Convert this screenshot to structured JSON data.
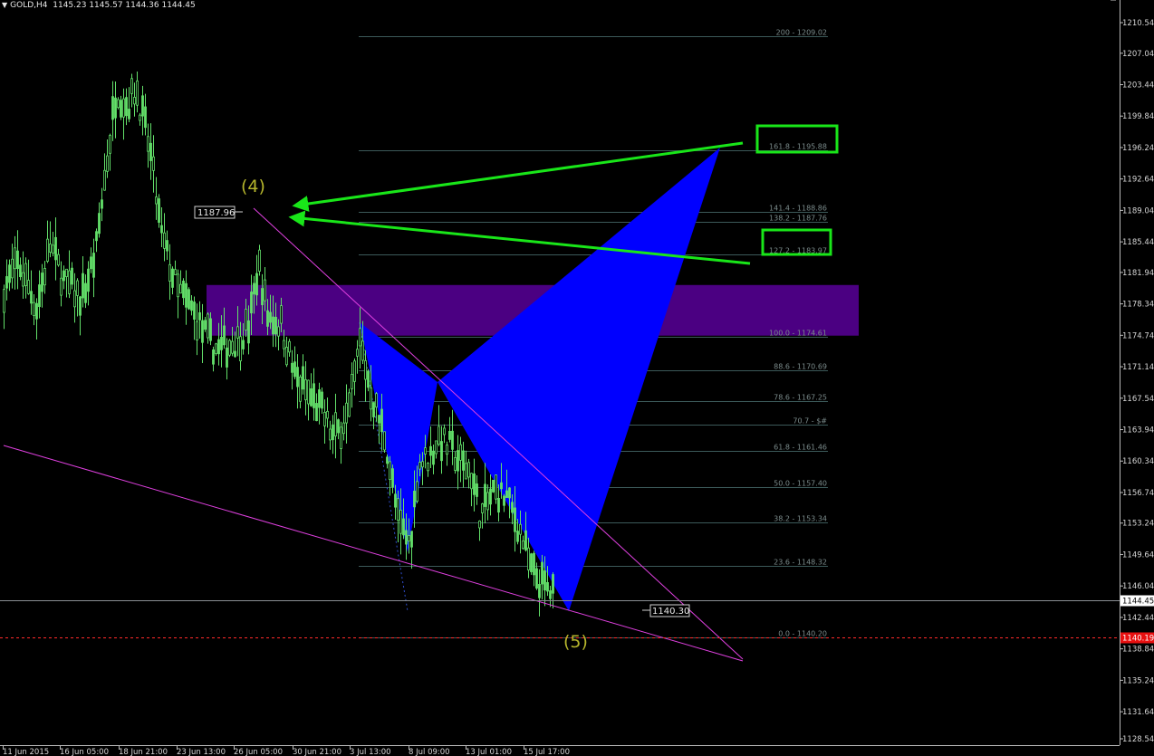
{
  "header": {
    "symbol": "GOLD,H4",
    "ohlc": "1145.23 1145.57 1144.36 1144.45"
  },
  "colors": {
    "background": "#000000",
    "candle": "#63e06a",
    "price_line": "#9aa0a6",
    "ask_line": "#ff2a2a",
    "trendline": "#e040e0",
    "pattern": "#0000ff",
    "zone": "#4b0082",
    "arrow": "#19e619",
    "label_wave": "#b5b52c",
    "fib_line": "#2f4f4f"
  },
  "wave_labels": {
    "w4": "(4)",
    "w5": "(5)"
  },
  "price_tags": {
    "high": "1187.96",
    "low": "1140.30"
  },
  "chart_data": {
    "type": "candlestick",
    "symbol": "GOLD",
    "timeframe": "H4",
    "ylim": [
      1126.5,
      1212.0
    ],
    "y_ticks": [
      "1210.54",
      "1207.04",
      "1203.44",
      "1199.84",
      "1196.24",
      "1192.64",
      "1189.04",
      "1185.44",
      "1181.94",
      "1178.34",
      "1174.74",
      "1171.14",
      "1167.54",
      "1163.94",
      "1160.34",
      "1156.74",
      "1153.24",
      "1149.64",
      "1146.04",
      "1142.44",
      "1138.84",
      "1135.24",
      "1131.64",
      "1128.54"
    ],
    "x_ticks": [
      "11 Jun 2015",
      "16 Jun 05:00",
      "18 Jun 21:00",
      "23 Jun 13:00",
      "26 Jun 05:00",
      "30 Jun 21:00",
      "3 Jul 13:00",
      "8 Jul 09:00",
      "13 Jul 01:00",
      "15 Jul 17:00"
    ],
    "current_price": "1144.45",
    "ask_price": "1140.19",
    "fib_levels": [
      {
        "label": "200 - 1209.02",
        "value": 1209.02
      },
      {
        "label": "161.8 - 1195.88",
        "value": 1195.88
      },
      {
        "label": "141.4 - 1188.86",
        "value": 1188.86
      },
      {
        "label": "138.2 - 1187.76",
        "value": 1187.76
      },
      {
        "label": "127.2 - 1183.97",
        "value": 1183.97
      },
      {
        "label": "100.0 - 1174.61",
        "value": 1174.61
      },
      {
        "label": "88.6 - 1170.69",
        "value": 1170.69
      },
      {
        "label": "78.6 - 1167.25",
        "value": 1167.25
      },
      {
        "label": "70.7 - $#",
        "value": 1164.52
      },
      {
        "label": "61.8 - 1161.46",
        "value": 1161.46
      },
      {
        "label": "50.0 - 1157.40",
        "value": 1157.4
      },
      {
        "label": "38.2 - 1153.34",
        "value": 1153.34
      },
      {
        "label": "23.6 - 1148.32",
        "value": 1148.32
      },
      {
        "label": "0.0 - 1140.20",
        "value": 1140.2
      }
    ],
    "highlighted_levels": [
      "161.8 - 1195.88",
      "127.2 - 1183.97"
    ],
    "zone": {
      "top": 1180.5,
      "bottom": 1174.7
    },
    "pattern_points": [
      {
        "x": "3 Jul 13:00",
        "price": 1175.0
      },
      {
        "x": "8 Jul 09:00",
        "price": 1168.0
      },
      {
        "x": "after 15 Jul",
        "price": 1195.9
      },
      {
        "x": "after 15 Jul",
        "price": 1140.3
      }
    ],
    "wave_points": [
      {
        "label": "(4)",
        "price": 1187.96
      },
      {
        "label": "(5)",
        "price": 1140.3
      }
    ],
    "trendlines": [
      "upper wedge line from (4) 1187.96 down through 1140.30 region",
      "lower wedge line from left edge to 1134.0"
    ],
    "series_description": "price rallies to ~1206 near 18 Jun, declines with lower highs to ~1144.45 by 15 Jul"
  }
}
